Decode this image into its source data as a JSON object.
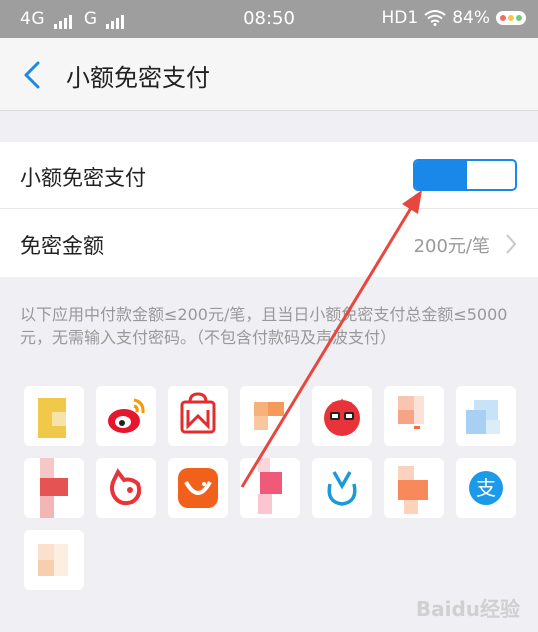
{
  "status_bar": {
    "carrier1": "4G",
    "carrier2": "G",
    "time": "08:50",
    "hd": "HD1",
    "battery": "84%"
  },
  "header": {
    "title": "小额免密支付"
  },
  "settings": {
    "toggle_label": "小额免密支付",
    "toggle_state": "on",
    "amount_label": "免密金额",
    "amount_value": "200元/笔"
  },
  "description": "以下应用中付款金额≤200元/笔，且当日小额免密支付总金额≤5000元，无需输入支付密码。（不包含付款码及声波支付）",
  "apps": [
    {
      "name": "app-1-icon",
      "row": 0,
      "col": 0
    },
    {
      "name": "weibo-icon",
      "row": 0,
      "col": 1
    },
    {
      "name": "shopping-bag-icon",
      "row": 0,
      "col": 2
    },
    {
      "name": "app-4-icon",
      "row": 0,
      "col": 3
    },
    {
      "name": "bird-icon",
      "row": 0,
      "col": 4
    },
    {
      "name": "app-6-icon",
      "row": 0,
      "col": 5
    },
    {
      "name": "app-7-icon",
      "row": 0,
      "col": 6
    },
    {
      "name": "app-8-icon",
      "row": 1,
      "col": 0
    },
    {
      "name": "cat-icon",
      "row": 1,
      "col": 1
    },
    {
      "name": "smile-icon",
      "row": 1,
      "col": 2
    },
    {
      "name": "app-11-icon",
      "row": 1,
      "col": 3
    },
    {
      "name": "drop-icon",
      "row": 1,
      "col": 4
    },
    {
      "name": "app-13-icon",
      "row": 1,
      "col": 5
    },
    {
      "name": "alipay-icon",
      "row": 1,
      "col": 6
    },
    {
      "name": "app-15-icon",
      "row": 2,
      "col": 0
    }
  ],
  "colors": {
    "accent": "#1a88e8",
    "arrow": "#e8473e"
  },
  "watermark": "Baidu经验"
}
